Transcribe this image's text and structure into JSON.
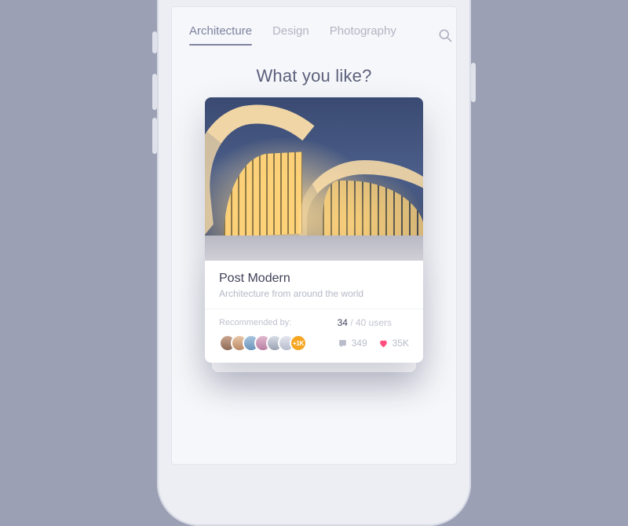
{
  "tabs": {
    "items": [
      {
        "label": "Architecture",
        "active": true
      },
      {
        "label": "Design",
        "active": false
      },
      {
        "label": "Photography",
        "active": false
      }
    ]
  },
  "heading": "What you like?",
  "card": {
    "title": "Post Modern",
    "subtitle": "Architecture from around the world",
    "recommended_label": "Recommended by:",
    "count_bold": "34",
    "count_rest": " / 40 users",
    "more_avatar_label": "+1K",
    "comments": "349",
    "likes": "35K"
  }
}
